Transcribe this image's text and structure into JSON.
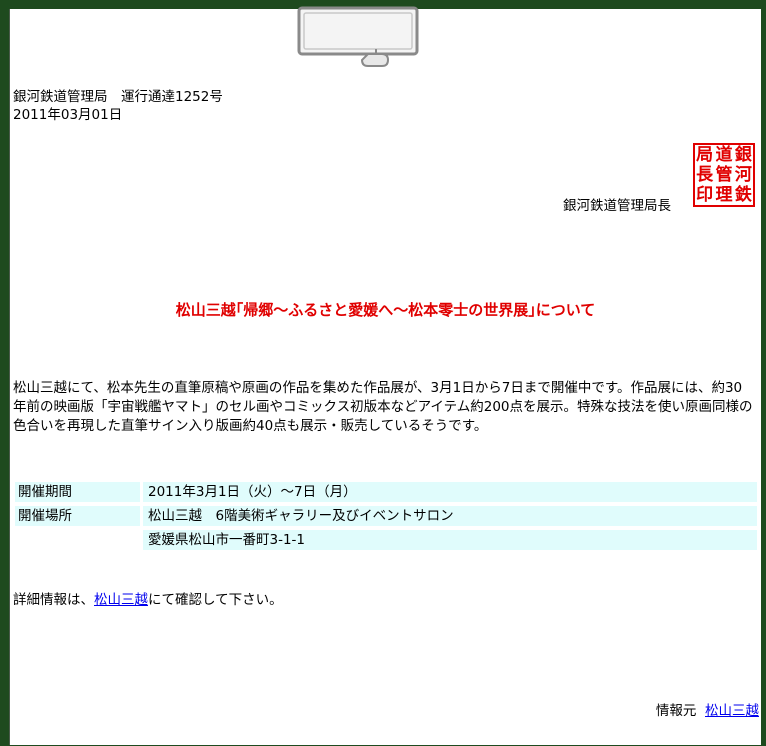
{
  "header": {
    "bureau_line": "銀河鉄道管理局　運行通達1252号",
    "date": "2011年03月01日",
    "sender": "銀河鉄道管理局長"
  },
  "stamp": {
    "characters": [
      "局",
      "長",
      "印",
      "道",
      "管",
      "理",
      "銀",
      "河",
      "鉄"
    ],
    "color": "#e00000"
  },
  "notice": {
    "title": "松山三越｢帰郷～ふるさと愛媛へ～松本零士の世界展｣について",
    "body": "松山三越にて、松本先生の直筆原稿や原画の作品を集めた作品展が、3月1日から7日まで開催中です。作品展には、約30年前の映画版「宇宙戦艦ヤマト」のセル画やコミックス初版本などアイテム約200点を展示。特殊な技法を使い原画同様の色合いを再現した直筆サイン入り版画約40点も展示・販売しているそうです。"
  },
  "details": {
    "period_label": "開催期間",
    "period_value": "2011年3月1日（火）～7日（月）",
    "venue_label": "開催場所",
    "venue_value": "松山三越　6階美術ギャラリー及びイベントサロン",
    "address_value": "愛媛県松山市一番町3-1-1"
  },
  "more_info": {
    "prefix": "詳細情報は、",
    "link": "松山三越",
    "suffix": "にて確認して下さい。"
  },
  "source": {
    "label": "情報元",
    "link": "松山三越"
  },
  "colors": {
    "background": "#1e4a1e",
    "accent_red": "#e00000",
    "table_row_bg": "#e0fcfc",
    "link": "#0000ee"
  }
}
